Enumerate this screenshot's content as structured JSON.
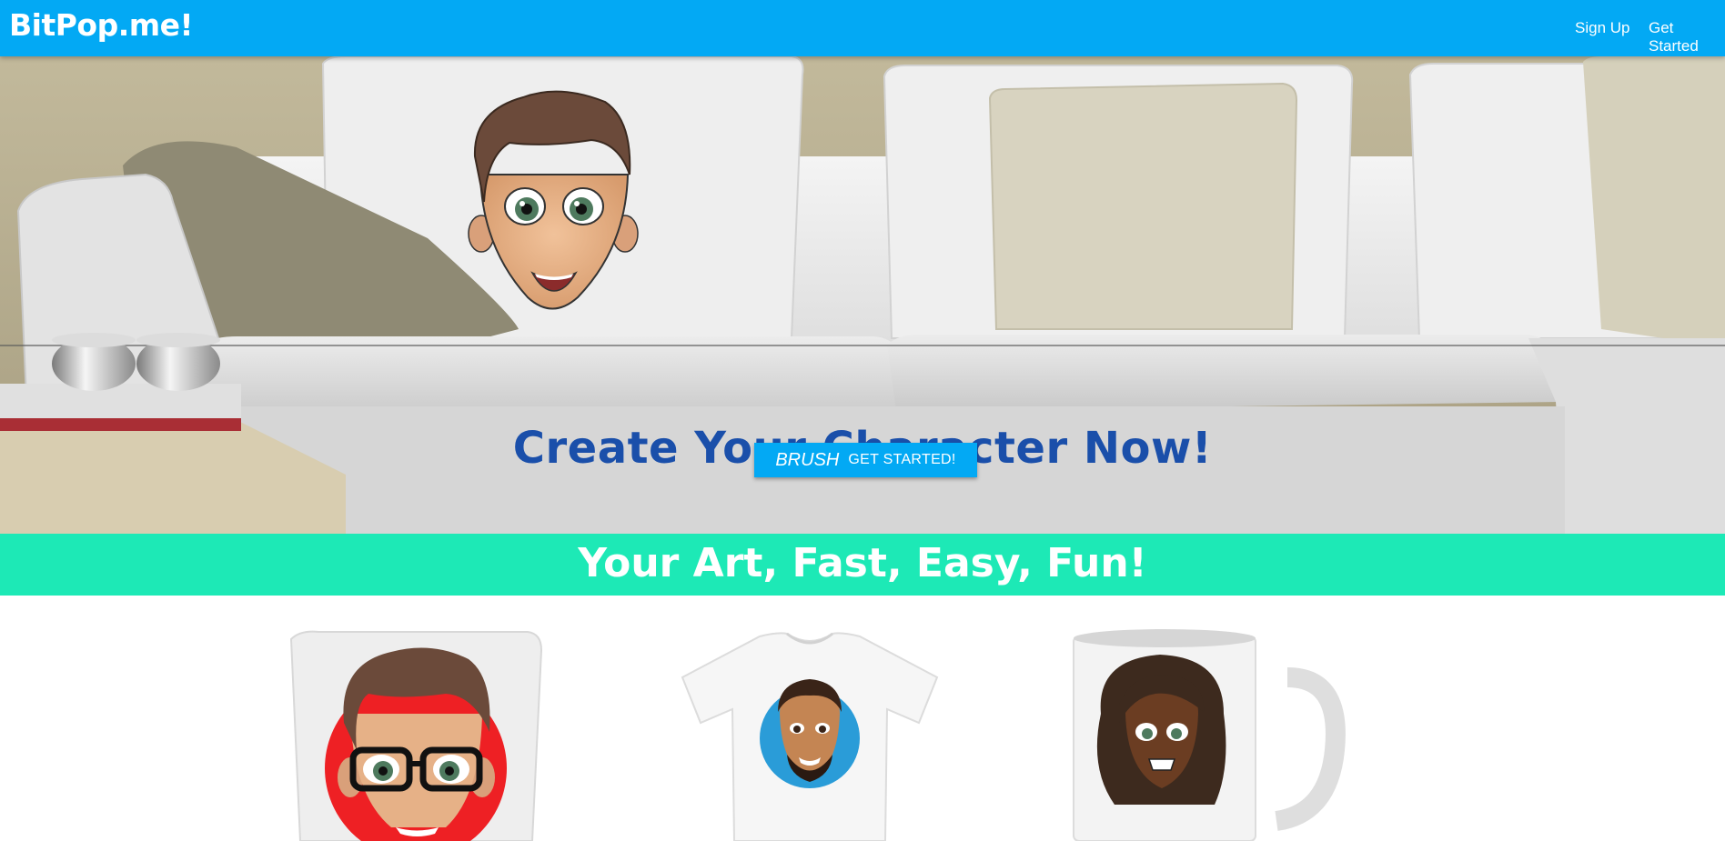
{
  "navbar": {
    "brand": "BitPop.me!",
    "links": [
      {
        "label": "Sign Up"
      },
      {
        "label": "Get Started"
      }
    ],
    "background_color": "#03a9f4"
  },
  "hero": {
    "title": "Create Your Character Now!",
    "button": {
      "icon_text": "BRUSH",
      "label": "GET STARTED!",
      "color": "#03a9f4"
    },
    "title_color": "#1a4faa"
  },
  "band": {
    "title": "Your Art, Fast, Easy, Fun!",
    "background_color": "#1de9b6"
  },
  "products": [
    {
      "type": "pillow",
      "icon": "pillow-product-image"
    },
    {
      "type": "t-shirt",
      "icon": "tshirt-product-image"
    },
    {
      "type": "mug",
      "icon": "mug-product-image"
    }
  ]
}
